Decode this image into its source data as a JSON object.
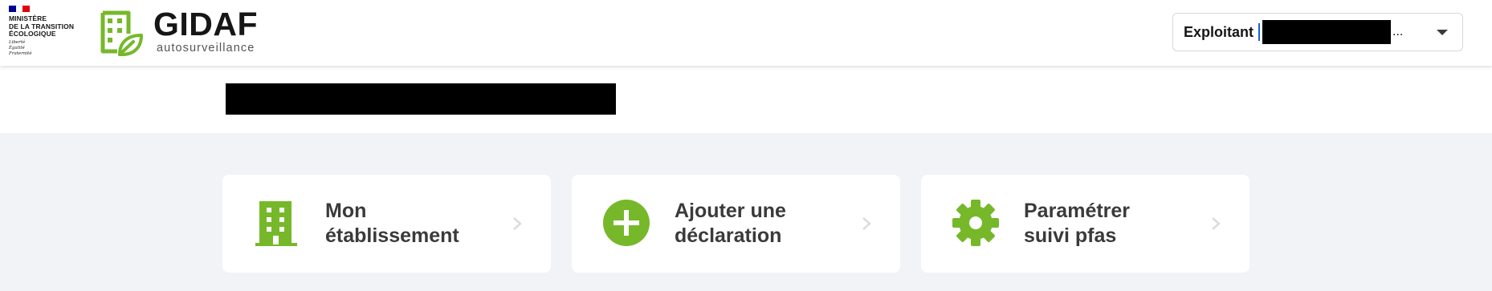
{
  "ministry": {
    "lines": [
      "MINISTÈRE",
      "DE LA TRANSITION",
      "ÉCOLOGIQUE"
    ],
    "motto": [
      "Liberté",
      "Égalité",
      "Fraternité"
    ],
    "flag_colors": [
      "#000091",
      "#ffffff",
      "#e1000f"
    ]
  },
  "brand": {
    "name": "GIDAF",
    "subtitle": "autosurveillance",
    "accent": "#76b82a"
  },
  "account": {
    "role": "Exploitant",
    "name_suffix": "..."
  },
  "cards": [
    {
      "label_line1": "Mon",
      "label_line2": "établissement",
      "icon": "building-icon"
    },
    {
      "label_line1": "Ajouter une",
      "label_line2": "déclaration",
      "icon": "add-circle-icon"
    },
    {
      "label_line1": "Paramétrer",
      "label_line2": "suivi pfas",
      "icon": "gear-icon"
    }
  ]
}
